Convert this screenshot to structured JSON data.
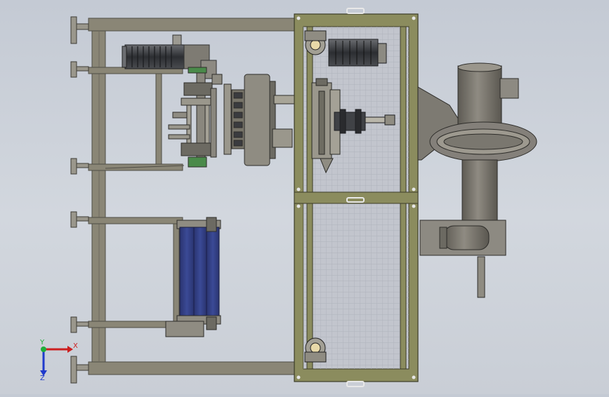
{
  "view": {
    "background_top": "#c4cad4",
    "background_bottom": "#c9ced6"
  },
  "colors": {
    "frame": "#8a8676",
    "frame_dark": "#5c5a50",
    "guard_frame": "#8b8c5e",
    "mesh": "#b9bcc6",
    "motor": "#3a3c40",
    "belt": "#2f3a78",
    "duct": "#7d7a72",
    "green_hub": "#4a8a4a"
  },
  "triad": {
    "x_label": "X",
    "y_label": "Y",
    "z_label": "Z",
    "x_color": "#cc1f1f",
    "y_color": "#1fae3a",
    "z_color": "#1f3acc"
  }
}
